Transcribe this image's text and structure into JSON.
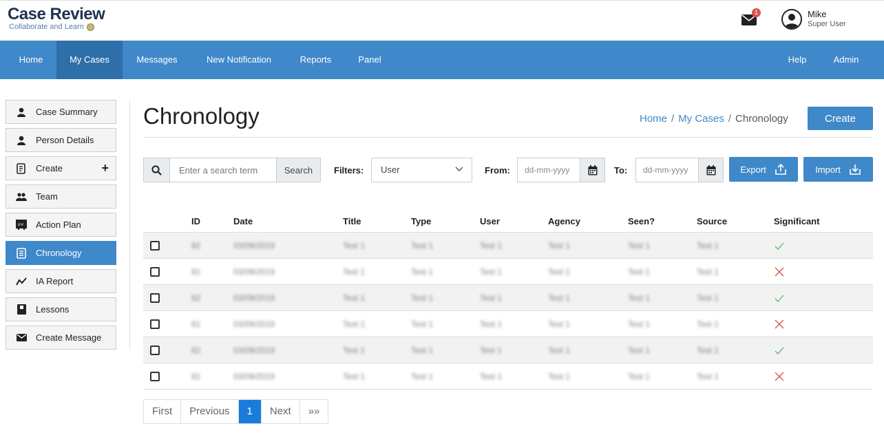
{
  "app": {
    "logo_title": "Case Review",
    "logo_subtitle": "Collaborate and Learn"
  },
  "header": {
    "mail_badge": "1",
    "user_name": "Mike",
    "user_role": "Super User"
  },
  "nav": {
    "items": [
      {
        "label": "Home"
      },
      {
        "label": "My Cases",
        "active": true
      },
      {
        "label": "Messages"
      },
      {
        "label": "New Notification"
      },
      {
        "label": "Reports"
      },
      {
        "label": "Panel"
      }
    ],
    "right_items": [
      {
        "label": "Help"
      },
      {
        "label": "Admin"
      }
    ]
  },
  "sidebar": {
    "items": [
      {
        "label": "Case Summary",
        "icon": "person-icon"
      },
      {
        "label": "Person Details",
        "icon": "person-icon"
      },
      {
        "label": "Create",
        "icon": "document-edit-icon",
        "extra": "+"
      },
      {
        "label": "Team",
        "icon": "people-icon"
      },
      {
        "label": "Action Plan",
        "icon": "board-icon"
      },
      {
        "label": "Chronology",
        "icon": "document-icon",
        "active": true
      },
      {
        "label": "IA Report",
        "icon": "trend-line-icon"
      },
      {
        "label": "Lessons",
        "icon": "book-icon"
      },
      {
        "label": "Create Message",
        "icon": "envelope-icon"
      }
    ]
  },
  "main": {
    "title": "Chronology",
    "breadcrumb": [
      "Home",
      "My Cases",
      "Chronology"
    ],
    "breadcrumb_sep": "/",
    "create_label": "Create"
  },
  "toolbar": {
    "search_placeholder": "Enter a search term",
    "search_label": "Search",
    "filters_label": "Filters:",
    "filter_value": "User",
    "from_label": "From:",
    "to_label": "To:",
    "date_placeholder": "dd-mm-yyyy",
    "export_label": "Export",
    "import_label": "Import"
  },
  "table": {
    "columns": [
      "ID",
      "Date",
      "Title",
      "Type",
      "User",
      "Agency",
      "Seen?",
      "Source",
      "Significant"
    ],
    "rows": [
      {
        "id": "82",
        "date": "03/09/2019",
        "title": "Test 1",
        "type": "Test 1",
        "user": "Test 1",
        "agency": "Test 1",
        "seen": "Test 1",
        "source": "Test 1",
        "significant": true
      },
      {
        "id": "81",
        "date": "03/09/2019",
        "title": "Test 1",
        "type": "Test 1",
        "user": "Test 1",
        "agency": "Test 1",
        "seen": "Test 1",
        "source": "Test 1",
        "significant": false
      },
      {
        "id": "82",
        "date": "03/09/2019",
        "title": "Test 1",
        "type": "Test 1",
        "user": "Test 1",
        "agency": "Test 1",
        "seen": "Test 1",
        "source": "Test 1",
        "significant": true
      },
      {
        "id": "81",
        "date": "03/09/2019",
        "title": "Test 1",
        "type": "Test 1",
        "user": "Test 1",
        "agency": "Test 1",
        "seen": "Test 1",
        "source": "Test 1",
        "significant": false
      },
      {
        "id": "82",
        "date": "03/09/2019",
        "title": "Test 1",
        "type": "Test 1",
        "user": "Test 1",
        "agency": "Test 1",
        "seen": "Test 1",
        "source": "Test 1",
        "significant": true
      },
      {
        "id": "81",
        "date": "03/09/2019",
        "title": "Test 1",
        "type": "Test 1",
        "user": "Test 1",
        "agency": "Test 1",
        "seen": "Test 1",
        "source": "Test 1",
        "significant": false
      }
    ]
  },
  "pagination": {
    "first": "First",
    "previous": "Previous",
    "current": "1",
    "next": "Next",
    "last": "»»"
  },
  "colors": {
    "primary": "#3f88c9",
    "nav_active": "#2f6fa9",
    "page_active": "#1a7bdb",
    "check": "#5cb85c",
    "cross": "#d9534f"
  }
}
